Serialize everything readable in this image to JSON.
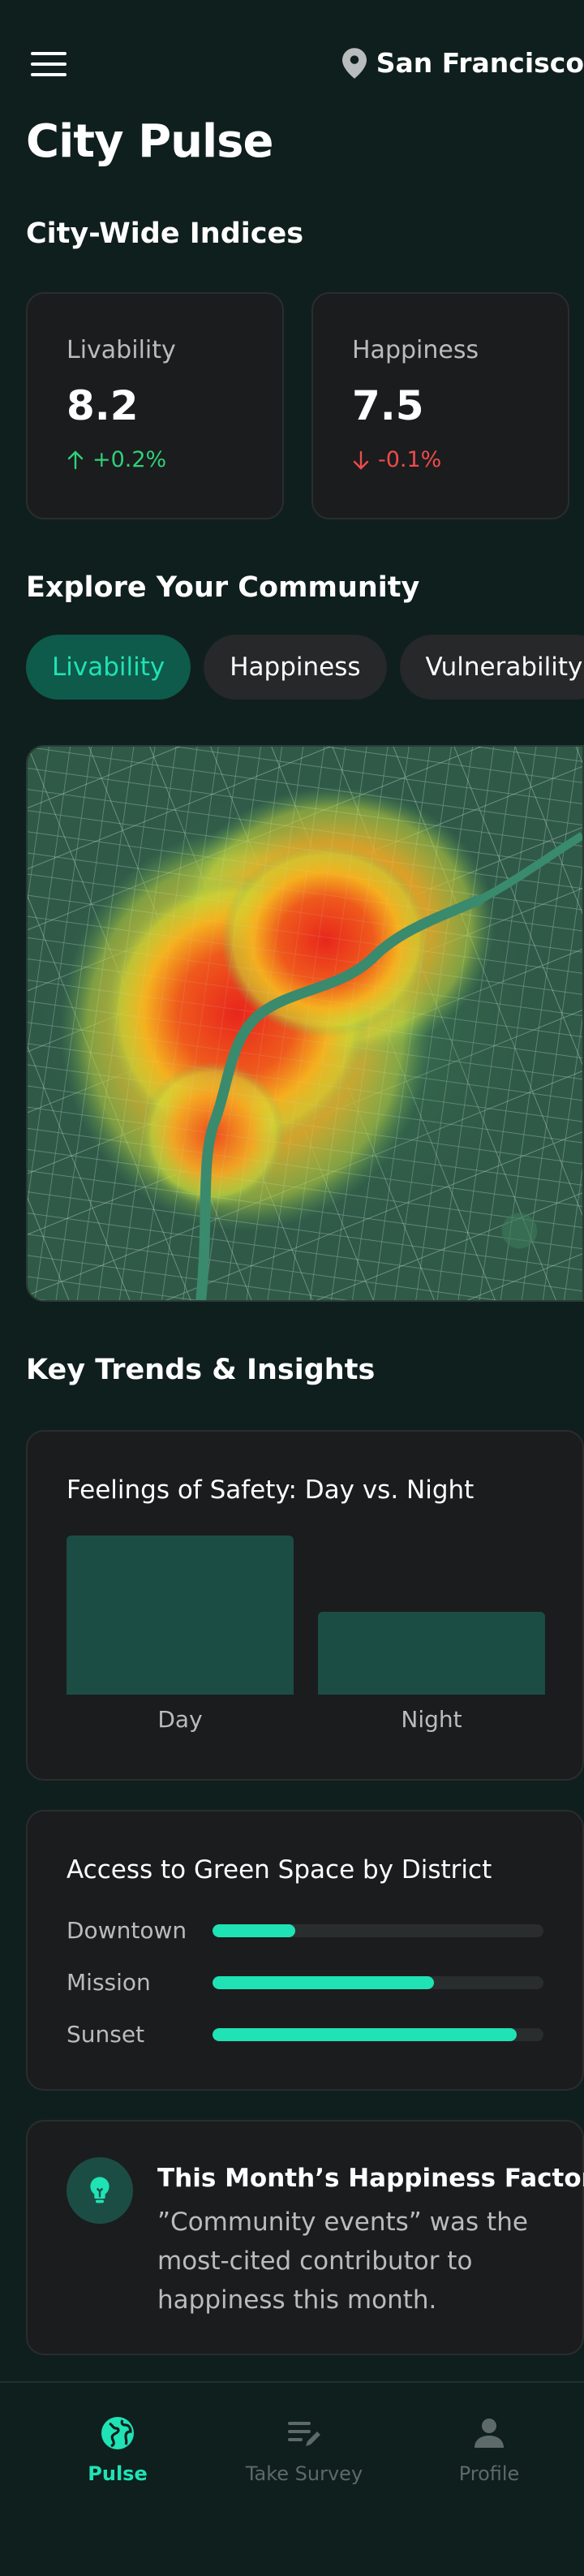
{
  "header": {
    "location": "San Francisco",
    "page_title": "City Pulse"
  },
  "indices": {
    "title": "City-Wide Indices",
    "cards": [
      {
        "label": "Livability",
        "value": "8.2",
        "delta": "+0.2%",
        "trend": "up"
      },
      {
        "label": "Happiness",
        "value": "7.5",
        "delta": "-0.1%",
        "trend": "down"
      }
    ]
  },
  "explore": {
    "title": "Explore Your Community",
    "tabs": [
      {
        "label": "Livability",
        "active": true
      },
      {
        "label": "Happiness",
        "active": false
      },
      {
        "label": "Vulnerability",
        "active": false
      }
    ]
  },
  "trends": {
    "title": "Key Trends & Insights",
    "safety": {
      "title": "Feelings of Safety: Day vs. Night",
      "labels": [
        "Day",
        "Night"
      ]
    },
    "green_space": {
      "title": "Access to Green Space by District",
      "districts": [
        {
          "name": "Downtown",
          "level": 0.25
        },
        {
          "name": "Mission",
          "level": 0.67
        },
        {
          "name": "Sunset",
          "level": 0.92
        }
      ]
    },
    "happiness_factor": {
      "title": "This Month’s Happiness Factor",
      "text": "”Community events” was the most-cited contributor to happiness this month."
    }
  },
  "chart_data": {
    "type": "bar",
    "title": "Feelings of Safety: Day vs. Night",
    "categories": [
      "Day",
      "Night"
    ],
    "values": [
      1.0,
      0.52
    ],
    "ylim": [
      0,
      1
    ],
    "grid": false
  },
  "nav": {
    "items": [
      {
        "label": "Pulse",
        "active": true,
        "icon": "globe-icon"
      },
      {
        "label": "Take Survey",
        "active": false,
        "icon": "edit-list-icon"
      },
      {
        "label": "Profile",
        "active": false,
        "icon": "person-icon"
      }
    ]
  },
  "colors": {
    "accent": "#1fe3b5",
    "background": "#0f1f1d",
    "card": "#1b1c1d",
    "up": "#2fd07a",
    "down": "#ef4b4b",
    "bar": "#1c4d45"
  }
}
